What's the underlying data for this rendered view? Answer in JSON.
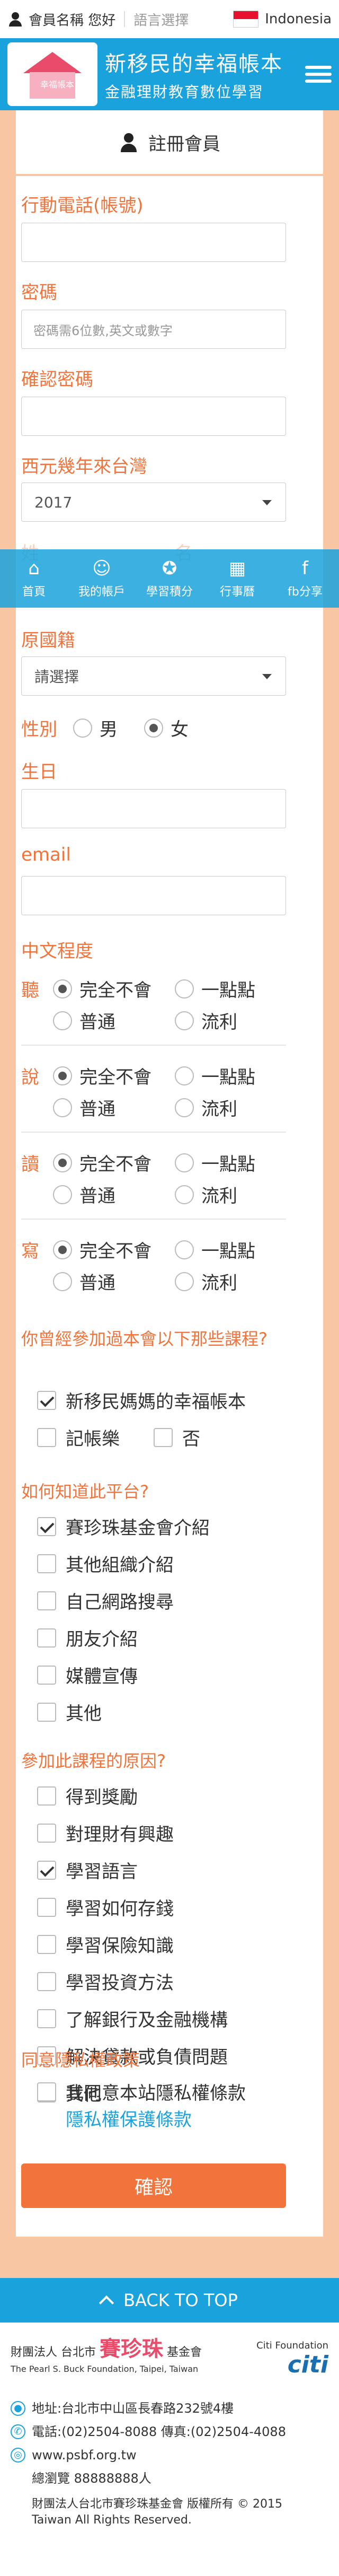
{
  "topbar": {
    "member_label": "會員名稱 您好",
    "lang_label": "語言選擇",
    "lang_value": "Indonesia"
  },
  "header": {
    "logo_badge": "幸福帳本",
    "title": "新移民的幸福帳本",
    "subtitle": "金融理財教育數位學習"
  },
  "page": {
    "title": "註冊會員"
  },
  "form": {
    "phone_label": "行動電話(帳號)",
    "password_label": "密碼",
    "password_placeholder": "密碼需6位數,英文或數字",
    "confirm_label": "確認密碼",
    "year_label": "西元幾年來台灣",
    "year_value": "2017",
    "surname_label": "姓",
    "name_label": "名",
    "origin_label": "原國籍",
    "origin_value": "請選擇",
    "gender_label": "性別",
    "gender_male": "男",
    "gender_female": "女",
    "birthday_label": "生日",
    "email_label": "email",
    "chinese_label": "中文程度",
    "skills": [
      {
        "label": "聽",
        "opts": [
          "完全不會",
          "一點點",
          "普通",
          "流利"
        ],
        "selected": 0
      },
      {
        "label": "說",
        "opts": [
          "完全不會",
          "一點點",
          "普通",
          "流利"
        ],
        "selected": 0
      },
      {
        "label": "讀",
        "opts": [
          "完全不會",
          "一點點",
          "普通",
          "流利"
        ],
        "selected": 0
      },
      {
        "label": "寫",
        "opts": [
          "完全不會",
          "一點點",
          "普通",
          "流利"
        ],
        "selected": 0
      }
    ],
    "q1": {
      "label": "你曾經參加過本會以下那些課程?",
      "opts": [
        "新移民媽媽的幸福帳本",
        "記帳樂",
        "否"
      ],
      "checked": [
        true,
        false,
        false
      ]
    },
    "q2": {
      "label": "如何知道此平台?",
      "opts": [
        "賽珍珠基金會介紹",
        "其他組織介紹",
        "自己網路搜尋",
        "朋友介紹",
        "媒體宣傳",
        "其他"
      ],
      "checked": [
        true,
        false,
        false,
        false,
        false,
        false
      ]
    },
    "q3": {
      "label": "參加此課程的原因?",
      "opts": [
        "得到獎勵",
        "對理財有興趣",
        "學習語言",
        "學習如何存錢",
        "學習保險知識",
        "學習投資方法",
        "了解銀行及金融機構",
        "解決貸款或負債問題",
        "其他"
      ],
      "checked": [
        false,
        false,
        true,
        false,
        false,
        false,
        false,
        false,
        false
      ]
    },
    "privacy_label": "同意隱私權政策",
    "privacy_text": "我同意本站隱私權條款",
    "privacy_link": "隱私權保護條款",
    "submit": "確認"
  },
  "bottom_nav": [
    {
      "label": "首頁",
      "icon": "home-icon"
    },
    {
      "label": "我的帳戶",
      "icon": "account-icon"
    },
    {
      "label": "學習積分",
      "icon": "badge-icon"
    },
    {
      "label": "行事曆",
      "icon": "calendar-icon"
    },
    {
      "label": "fb分享",
      "icon": "facebook-icon"
    }
  ],
  "back_to_top": "BACK TO TOP",
  "footer": {
    "org_line1": "財團法人",
    "org_line2": "台北市",
    "org_name": "賽珍珠",
    "org_suffix": "基金會",
    "org_en": "The Pearl S. Buck Foundation, Taipei, Taiwan",
    "citi_label": "Citi Foundation",
    "citi_logo": "citi",
    "address": "地址:台北市中山區長春路232號4樓",
    "phone": "電話:(02)2504-8088 傳真:(02)2504-4088",
    "web": "www.psbf.org.tw",
    "views": "總瀏覽 88888888人",
    "copy1": "財團法人台北市賽珍珠基金會 版權所有 © 2015",
    "copy2": "Taiwan All Rights Reserved."
  },
  "colors": {
    "primary": "#19a2dc",
    "accent": "#f0743c",
    "background": "#f8c6a3"
  }
}
